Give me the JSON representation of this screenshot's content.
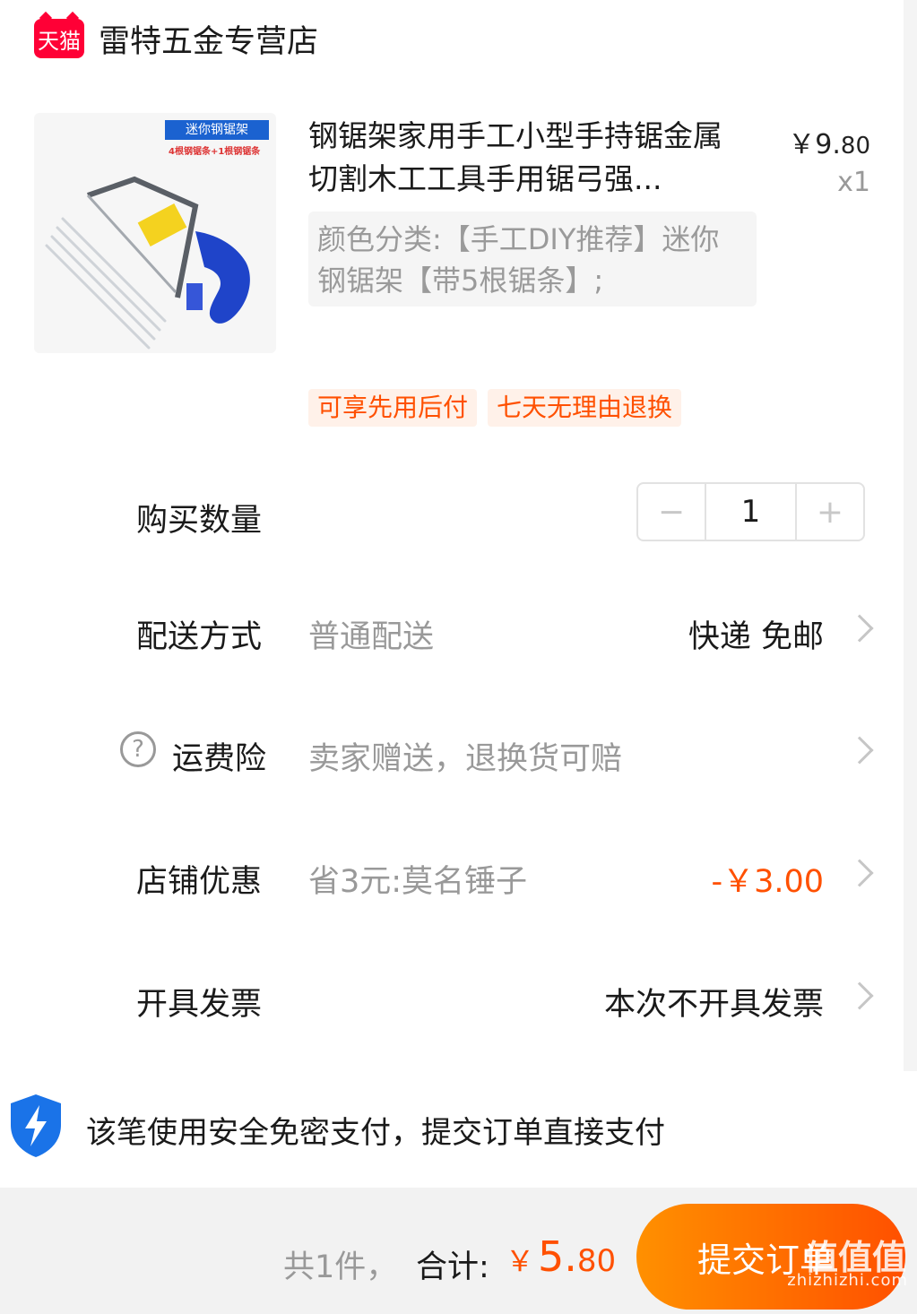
{
  "store": {
    "badge": "天猫",
    "name": "雷特五金专营店"
  },
  "product": {
    "image_banner": "迷你钢锯架",
    "image_sub": "4根钢锯条+1根钢锯条",
    "title": "钢锯架家用手工小型手持锯金属切割木工工具手用锯弓强...",
    "price_symbol": "￥",
    "price_int": "9.",
    "price_dec": "80",
    "quantity_label": "x1",
    "sku": "颜色分类:【手工DIY推荐】迷你钢锯架【带5根锯条】;"
  },
  "tags": [
    "可享先用后付",
    "七天无理由退换"
  ],
  "quantity": {
    "label": "购买数量",
    "minus": "−",
    "value": "1",
    "plus": "+"
  },
  "delivery": {
    "label": "配送方式",
    "desc": "普通配送",
    "value": "快递 免邮"
  },
  "shipping_insurance": {
    "icon": "help-icon",
    "label": "运费险",
    "desc": "卖家赠送，退换货可赔"
  },
  "store_discount": {
    "label": "店铺优惠",
    "desc": "省3元:莫名锤子",
    "value": "-￥3.00",
    "accent_color": "#ff5000"
  },
  "invoice": {
    "label": "开具发票",
    "value": "本次不开具发票"
  },
  "secure_pay": {
    "icon": "shield-lightning-icon",
    "text": "该笔使用安全免密支付，提交订单直接支付"
  },
  "footer": {
    "count_text": "共1件，",
    "total_label": "合计:",
    "total_currency": "￥",
    "total_int": "5.",
    "total_dec": "80",
    "submit_label": "提交订单"
  },
  "watermark": {
    "logo": "值值值",
    "url": "zhizhizhi.com"
  }
}
